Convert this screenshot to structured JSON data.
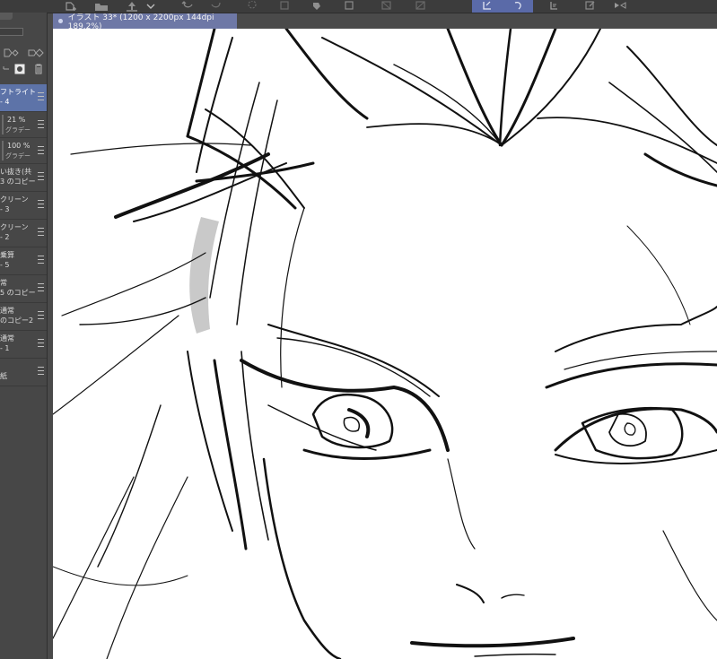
{
  "toolbar": {
    "buttons": [
      {
        "name": "new-layer-icon",
        "active": false
      },
      {
        "name": "folder-icon",
        "active": false
      },
      {
        "name": "export-icon",
        "active": false
      },
      {
        "name": "chevron-down-icon",
        "active": false
      },
      {
        "name": "undo-icon",
        "active": false
      },
      {
        "name": "redo-icon",
        "active": false
      },
      {
        "name": "spinner-icon",
        "active": false
      },
      {
        "name": "save-icon",
        "active": false
      },
      {
        "name": "fill-icon",
        "active": false
      },
      {
        "name": "transform-icon",
        "active": false
      },
      {
        "name": "select-icon",
        "active": false
      },
      {
        "name": "lasso-icon",
        "active": false
      },
      {
        "name": "frame-icon",
        "active": true
      },
      {
        "name": "rotate-icon",
        "active": true
      },
      {
        "name": "flip-icon",
        "active": false
      },
      {
        "name": "edit-icon",
        "active": false
      },
      {
        "name": "mirror-icon",
        "active": false
      }
    ]
  },
  "canvas_tab": {
    "title": "イラスト 33* (1200 x 2200px 144dpi 189.2%)"
  },
  "layers": [
    {
      "line1": "フトライト",
      "line2": "- 4",
      "selected": true
    },
    {
      "line1": "21 %",
      "line2": "グラデー",
      "sub": true
    },
    {
      "line1": "100 %",
      "line2": "グラデー",
      "sub": true
    },
    {
      "line1": "い抜き(共",
      "line2": "3 のコピー"
    },
    {
      "line1": "クリーン",
      "line2": "- 3"
    },
    {
      "line1": "クリーン",
      "line2": "- 2"
    },
    {
      "line1": "乗算",
      "line2": "- 5"
    },
    {
      "line1": "常",
      "line2": "5 のコピー"
    },
    {
      "line1": "通常",
      "line2": "のコピー2"
    },
    {
      "line1": "通常",
      "line2": "- 1"
    },
    {
      "line1": "",
      "line2": "紙"
    }
  ],
  "colors": {
    "accent": "#5d73a8",
    "panel": "#474747",
    "canvas": "#ffffff"
  }
}
